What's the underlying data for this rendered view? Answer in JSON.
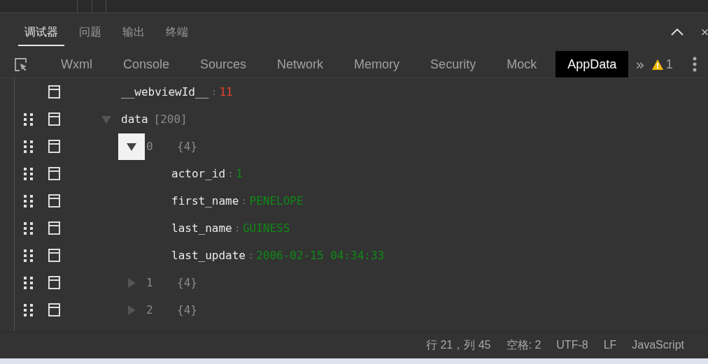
{
  "panel_tabs": [
    {
      "label": "调试器",
      "selected": true
    },
    {
      "label": "问题",
      "selected": false
    },
    {
      "label": "输出",
      "selected": false
    },
    {
      "label": "终端",
      "selected": false
    }
  ],
  "devtools_tabs": [
    {
      "label": "Wxml",
      "selected": false
    },
    {
      "label": "Console",
      "selected": false
    },
    {
      "label": "Sources",
      "selected": false
    },
    {
      "label": "Network",
      "selected": false
    },
    {
      "label": "Memory",
      "selected": false
    },
    {
      "label": "Security",
      "selected": false
    },
    {
      "label": "Mock",
      "selected": false
    },
    {
      "label": "AppData",
      "selected": true
    }
  ],
  "more_tabs": "»",
  "warning_count": "1",
  "tree": [
    {
      "key": "__webviewId__",
      "separator": ":",
      "value": "11",
      "color": "#e8412f",
      "draggable": false
    },
    {
      "key": "data",
      "count": "[200]",
      "expanded": true,
      "focused": false,
      "draggable": true,
      "children": [
        {
          "index": "0",
          "count": "{4}",
          "expanded": true,
          "focused": true,
          "draggable": true,
          "children": [
            {
              "key": "actor_id",
              "separator": ":",
              "value": "1",
              "color": "#0e8a16",
              "draggable": true
            },
            {
              "key": "first_name",
              "separator": ":",
              "value": "PENELOPE",
              "color": "#0e8a16",
              "draggable": true
            },
            {
              "key": "last_name",
              "separator": ":",
              "value": "GUINESS",
              "color": "#0e8a16",
              "draggable": true
            },
            {
              "key": "last_update",
              "separator": ":",
              "value": "2006-02-15 04:34:33",
              "color": "#0e8a16",
              "draggable": true
            }
          ]
        },
        {
          "index": "1",
          "count": "{4}",
          "expanded": false,
          "focused": false,
          "draggable": true
        },
        {
          "index": "2",
          "count": "{4}",
          "expanded": false,
          "focused": false,
          "draggable": true
        }
      ]
    }
  ],
  "status_bar": [
    "行 21，列 45",
    "空格: 2",
    "UTF-8",
    "LF",
    "JavaScript"
  ]
}
